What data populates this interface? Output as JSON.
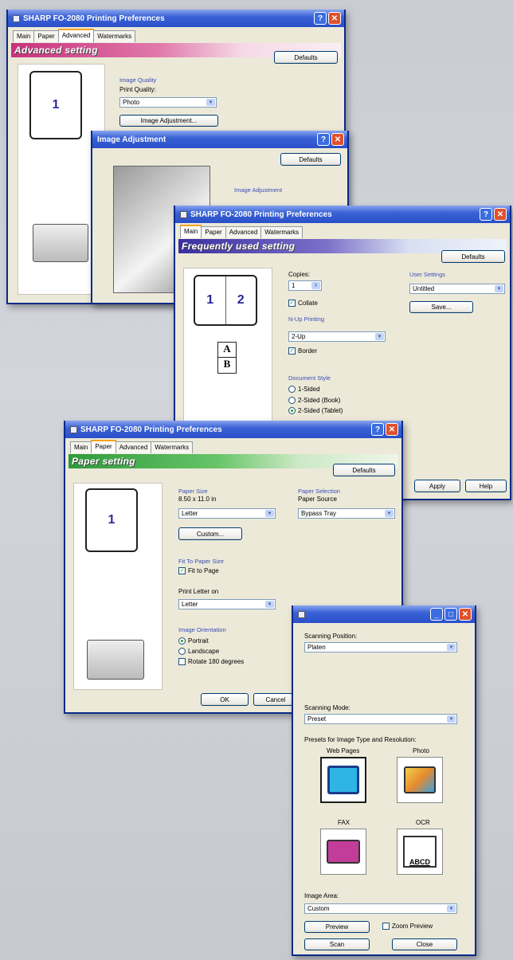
{
  "win_advanced": {
    "title": "SHARP FO-2080 Printing Preferences",
    "tabs": [
      "Main",
      "Paper",
      "Advanced",
      "Watermarks"
    ],
    "band": "Advanced setting",
    "defaults": "Defaults",
    "group_quality": "Image Quality",
    "print_quality_label": "Print Quality:",
    "print_quality_value": "Photo",
    "image_adjustment_btn": "Image Adjustment...",
    "page_number": "1"
  },
  "win_image_adj": {
    "title": "Image Adjustment",
    "defaults": "Defaults",
    "group": "Image Adjustment"
  },
  "win_main": {
    "title": "SHARP FO-2080 Printing Preferences",
    "tabs": [
      "Main",
      "Paper",
      "Advanced",
      "Watermarks"
    ],
    "band": "Frequently used setting",
    "defaults": "Defaults",
    "copies_label": "Copies:",
    "copies_value": "1",
    "collate": "Collate",
    "nup_group": "N-Up Printing",
    "nup_value": "2-Up",
    "border": "Border",
    "doc_style_group": "Document Style",
    "doc_styles": [
      "1-Sided",
      "2-Sided (Book)",
      "2-Sided (Tablet)"
    ],
    "user_settings_group": "User Settings",
    "user_settings_value": "Untitled",
    "save_btn": "Save...",
    "apply_btn": "Apply",
    "help_btn": "Help",
    "page_left": "1",
    "page_right": "2",
    "paper_a": "A",
    "paper_b": "B"
  },
  "win_paper": {
    "title": "SHARP FO-2080 Printing Preferences",
    "tabs": [
      "Main",
      "Paper",
      "Advanced",
      "Watermarks"
    ],
    "band": "Paper setting",
    "defaults": "Defaults",
    "paper_size_group": "Paper Size",
    "paper_size_dims": "8.50 x 11.0 in",
    "paper_size_value": "Letter",
    "custom_btn": "Custom...",
    "fit_group": "Fit To Paper Size",
    "fit_to_page": "Fit to Page",
    "print_letter_on": "Print Letter on",
    "print_letter_value": "Letter",
    "orientation_group": "Image Orientation",
    "portrait": "Portrait",
    "landscape": "Landscape",
    "rotate": "Rotate 180 degrees",
    "paper_selection_group": "Paper Selection",
    "paper_source_label": "Paper Source",
    "paper_source_value": "Bypass Tray",
    "ok_btn": "OK",
    "cancel_btn": "Cancel",
    "page_number": "1"
  },
  "win_scan": {
    "scanning_position_label": "Scanning Position:",
    "scanning_position_value": "Platen",
    "scanning_mode_label": "Scanning Mode:",
    "scanning_mode_value": "Preset",
    "presets_label": "Presets for Image Type and Resolution:",
    "presets": [
      "Web Pages",
      "Photo",
      "FAX",
      "OCR"
    ],
    "ocr_sample": "ABCD",
    "image_area_label": "Image Area:",
    "image_area_value": "Custom",
    "preview_btn": "Preview",
    "zoom_preview": "Zoom Preview",
    "scan_btn": "Scan",
    "close_btn": "Close"
  }
}
